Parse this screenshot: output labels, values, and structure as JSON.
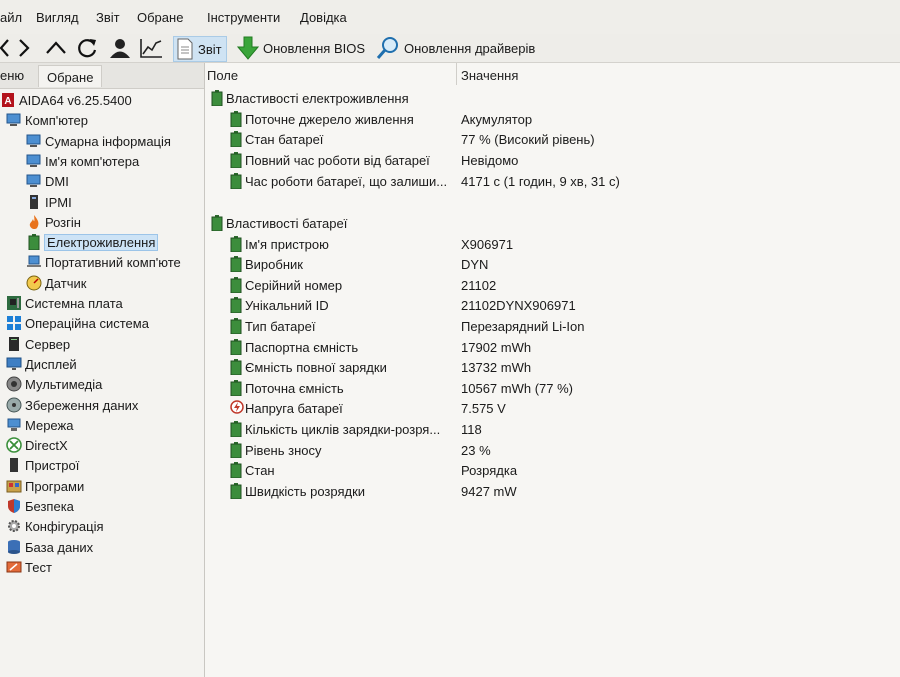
{
  "menu": [
    "айл",
    "Вигляд",
    "Звіт",
    "Обране",
    "Інструменти",
    "Довідка"
  ],
  "toolbar": {
    "report": "Звіт",
    "bios": "Оновлення BIOS",
    "drivers": "Оновлення драйверів"
  },
  "left_tabs": {
    "menu": "еню",
    "favorites": "Обране"
  },
  "tree": [
    {
      "label": "AIDA64 v6.25.5400",
      "icon": "aida-logo-icon"
    },
    {
      "label": "Комп'ютер",
      "icon": "computer-icon"
    },
    {
      "label": "Сумарна інформація",
      "icon": "computer-icon"
    },
    {
      "label": "Ім'я комп'ютера",
      "icon": "computer-icon"
    },
    {
      "label": "DMI",
      "icon": "computer-icon"
    },
    {
      "label": "IPMI",
      "icon": "ipmi-icon"
    },
    {
      "label": "Розгін",
      "icon": "flame-icon"
    },
    {
      "label": "Електроживлення",
      "icon": "battery-icon"
    },
    {
      "label": "Портативний комп'юте",
      "icon": "laptop-icon"
    },
    {
      "label": "Датчик",
      "icon": "gauge-icon"
    },
    {
      "label": "Системна плата",
      "icon": "motherboard-icon"
    },
    {
      "label": "Операційна система",
      "icon": "windows-icon"
    },
    {
      "label": "Сервер",
      "icon": "server-icon"
    },
    {
      "label": "Дисплей",
      "icon": "display-icon"
    },
    {
      "label": "Мультимедіа",
      "icon": "speaker-icon"
    },
    {
      "label": "Збереження даних",
      "icon": "storage-icon"
    },
    {
      "label": "Мережа",
      "icon": "network-icon"
    },
    {
      "label": "DirectX",
      "icon": "xbox-icon"
    },
    {
      "label": "Пристрої",
      "icon": "devices-icon"
    },
    {
      "label": "Програми",
      "icon": "programs-icon"
    },
    {
      "label": "Безпека",
      "icon": "shield-icon"
    },
    {
      "label": "Конфігурація",
      "icon": "config-icon"
    },
    {
      "label": "База даних",
      "icon": "database-icon"
    },
    {
      "label": "Тест",
      "icon": "test-icon"
    }
  ],
  "columns": {
    "field": "Поле",
    "value": "Значення"
  },
  "rows": [
    {
      "type": "section",
      "name": "Властивості електроживлення"
    },
    {
      "name": "Поточне джерело живлення",
      "value": "Акумулятор"
    },
    {
      "name": "Стан батареї",
      "value": "77 % (Високий рівень)"
    },
    {
      "name": "Повний час роботи від батареї",
      "value": "Невідомо"
    },
    {
      "name": "Час роботи батареї, що залиши...",
      "value": "4171 с (1 годин, 9 хв, 31 с)"
    },
    {
      "type": "section",
      "name": "Властивості батареї"
    },
    {
      "name": "Ім'я пристрою",
      "value": "X906971"
    },
    {
      "name": "Виробник",
      "value": "DYN"
    },
    {
      "name": "Серійний номер",
      "value": "21102"
    },
    {
      "name": "Унікальний ID",
      "value": "21102DYNX906971"
    },
    {
      "name": "Тип батареї",
      "value": "Перезарядний Li-Ion"
    },
    {
      "name": "Паспортна ємність",
      "value": "17902 mWh"
    },
    {
      "name": "Ємність повної зарядки",
      "value": "13732 mWh"
    },
    {
      "name": "Поточна ємність",
      "value": "10567 mWh  (77 %)"
    },
    {
      "name": "Напруга батареї",
      "value": "7.575 V",
      "icon": "voltage-icon"
    },
    {
      "name": "Кількість циклів зарядки-розря...",
      "value": "118"
    },
    {
      "name": "Рівень зносу",
      "value": "23 %"
    },
    {
      "name": "Стан",
      "value": "Розрядка"
    },
    {
      "name": "Швидкість розрядки",
      "value": "9427 mW"
    }
  ]
}
